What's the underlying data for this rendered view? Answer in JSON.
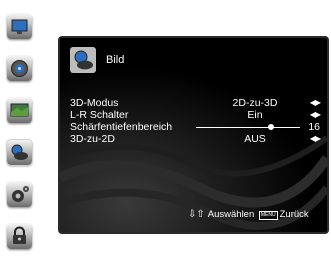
{
  "sidebar": {
    "items": [
      {
        "name": "picture-menu-icon"
      },
      {
        "name": "sound-menu-icon"
      },
      {
        "name": "channel-menu-icon"
      },
      {
        "name": "picture-3d-menu-icon"
      },
      {
        "name": "settings-menu-icon"
      },
      {
        "name": "lock-menu-icon"
      }
    ]
  },
  "menu": {
    "title": "Bild",
    "rows": [
      {
        "label": "3D-Modus",
        "value": "2D-zu-3D"
      },
      {
        "label": "L-R Schalter",
        "value": "Ein"
      },
      {
        "label": "Schärfentiefenbereich",
        "value": "16",
        "level": 0.72
      },
      {
        "label": "3D-zu-2D",
        "value": "AUS"
      }
    ],
    "footer": {
      "select_label": "Auswählen",
      "menu_key": "MENU",
      "back_label": "Zurück"
    }
  }
}
